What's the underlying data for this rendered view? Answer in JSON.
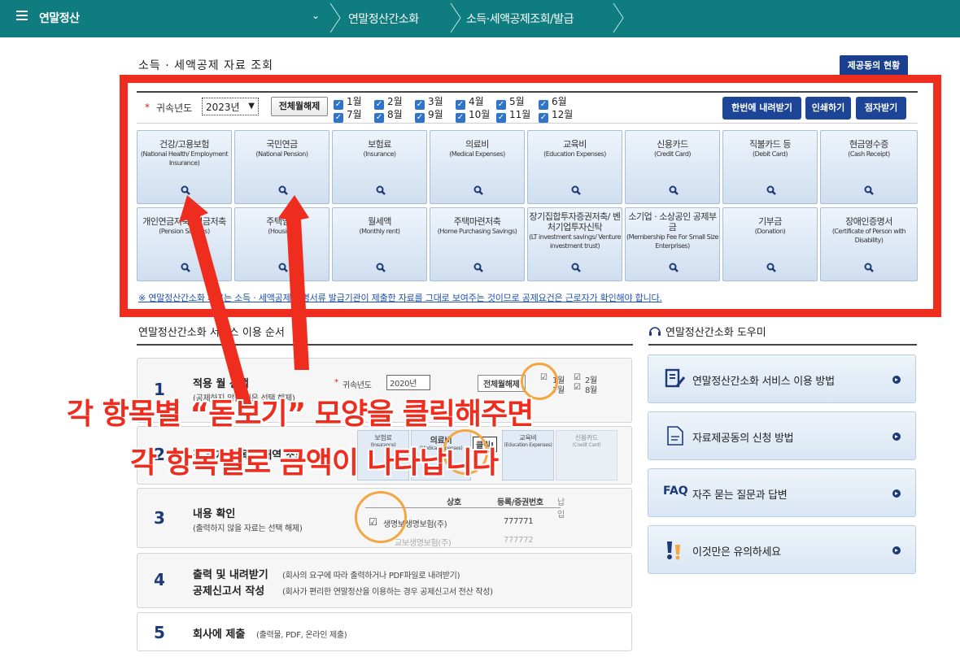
{
  "topbar": {
    "app_title": "연말정산",
    "crumb1": "연말정산간소화",
    "crumb2": "소득·세액공제조회/발급"
  },
  "section": {
    "title": "소득 · 세액공제 자료 조회",
    "joint_button": "제공동의 현황"
  },
  "filter": {
    "year_label": "귀속년도",
    "year_value": "2023년",
    "all_off_button": "전체월해제",
    "months_row1": [
      "1월",
      "2월",
      "3월",
      "4월",
      "5월",
      "6월"
    ],
    "months_row2": [
      "7월",
      "8월",
      "9월",
      "10월",
      "11월",
      "12월"
    ],
    "download_button": "한번에 내려받기",
    "print_button": "인쇄하기",
    "braille_button": "점자받기"
  },
  "tiles_row1": [
    {
      "ko": "건강/고용보험",
      "en": "(National Health/ Employment Insurance)"
    },
    {
      "ko": "국민연금",
      "en": "(National Pension)"
    },
    {
      "ko": "보험료",
      "en": "(Insurance)"
    },
    {
      "ko": "의료비",
      "en": "(Medical Expenses)"
    },
    {
      "ko": "교육비",
      "en": "(Education Expenses)"
    },
    {
      "ko": "신용카드",
      "en": "(Credit Card)"
    },
    {
      "ko": "직불카드 등",
      "en": "(Debit Card)"
    },
    {
      "ko": "현금영수증",
      "en": "(Cash Receipt)"
    }
  ],
  "tiles_row2": [
    {
      "ko": "개인연금저축/ 연금저축",
      "en": "(Pension Savings)"
    },
    {
      "ko": "주택임차",
      "en": "(Housing)"
    },
    {
      "ko": "월세액",
      "en": "(Monthly rent)"
    },
    {
      "ko": "주택마련저축",
      "en": "(Home Purchasing Savings)"
    },
    {
      "ko": "장기집합투자증권저축/ 벤처기업투자신탁",
      "en": "(LT investment savings/ Venture investment trust)"
    },
    {
      "ko": "소기업 · 소상공인 공제부금",
      "en": "(Membership Fee For Small Size Enterprises)"
    },
    {
      "ko": "기부금",
      "en": "(Donation)"
    },
    {
      "ko": "장애인증명서",
      "en": "(Certificate of Person with Disability)"
    }
  ],
  "note": "※ 연말정산간소화 자료는 소득 · 세액공제 증명서류 발급기관이 제출한 자료를 그대로 보여주는 것이므로 공제요건은 근로자가 확인해야 합니다.",
  "steps": {
    "title": "연말정산간소화 서비스 이용 순서",
    "items": [
      {
        "num": "1",
        "title": "적용 월 선택",
        "sub": "(공제하지 않을 월은 선택 해제)"
      },
      {
        "num": "2",
        "title": "각 공제 항목별 내역 조회",
        "sub": ""
      },
      {
        "num": "3",
        "title": "내용 확인",
        "sub": "(출력하지 않을 자료는 선택 해제)"
      },
      {
        "num": "4",
        "title": "출력 및 내려받기",
        "sub": "(회사의 요구에 따라 출력하거나 PDF파일로 내려받기)",
        "title2": "공제신고서 작성",
        "sub2": "(회사가 편리한 연말정산을 이용하는 경우 공제신고서 전산 작성)"
      },
      {
        "num": "5",
        "title": "회사에 제출",
        "sub": "(출력물, PDF, 온라인 제출)"
      }
    ],
    "mini": {
      "year_label": "귀속년도",
      "year_value": "2020년",
      "all_off": "전체월해제",
      "m1": "1월",
      "m2": "2월",
      "m7": "7월",
      "m8": "8월",
      "tile_a": "보험료",
      "tile_a_en": "(Insurance)",
      "tile_b": "의료비",
      "tile_b_en": "(Medical Expenses)",
      "tile_c": "교육비",
      "tile_c_en": "(Education Expenses)",
      "tile_d": "신용카드",
      "tile_d_en": "(Credit Card)",
      "click": "클릭!",
      "col1": "상호",
      "col2": "등록/증권번호",
      "col3": "납입",
      "row1_name": "생명보생명보험(주)",
      "row1_no": "777771",
      "row2_name": "교보생명보험(주)",
      "row2_no": "777772"
    }
  },
  "help": {
    "title": "연말정산간소화 도우미",
    "items": [
      {
        "label": "연말정산간소화 서비스 이용 방법",
        "icon": "document-pen-icon"
      },
      {
        "label": "자료제공동의 신청 방법",
        "icon": "document-icon"
      },
      {
        "label": "자주 묻는 질문과 답변",
        "icon": "faq-icon",
        "badge": "FAQ"
      },
      {
        "label": "이것만은 유의하세요",
        "icon": "exclamation-icon"
      }
    ]
  },
  "overlay": {
    "line1": "각 항목별 “돋보기” 모양을 클릭해주면",
    "line2": "각 항목별로 금액이 나타납니다"
  },
  "colors": {
    "nav": "#0f7c80",
    "button_blue": "#1d4597",
    "highlight_red": "#ee2d1e",
    "ring_orange": "#f4a640"
  }
}
